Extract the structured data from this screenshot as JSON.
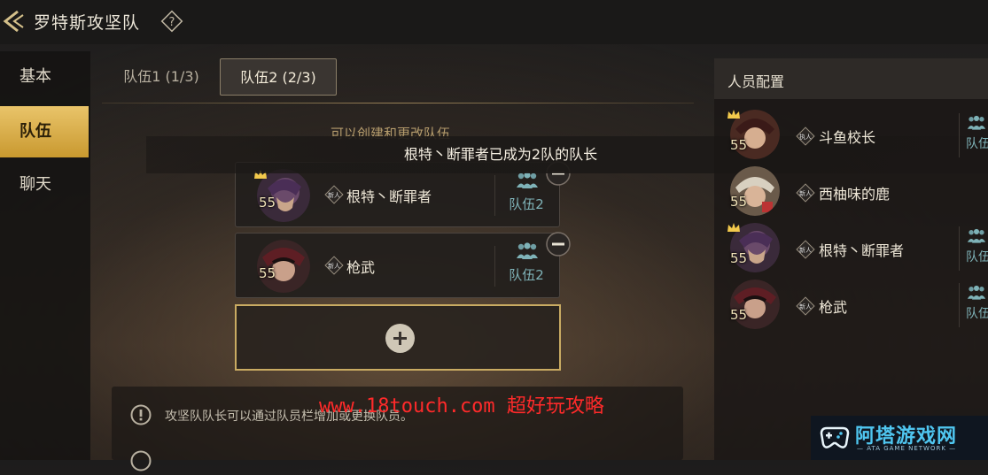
{
  "header": {
    "title": "罗特斯攻坚队",
    "back_icon": "back-arrow-icon",
    "help_icon": "help-icon"
  },
  "sidebar": {
    "items": [
      {
        "label": "基本",
        "active": false
      },
      {
        "label": "队伍",
        "active": true
      },
      {
        "label": "聊天",
        "active": false
      }
    ]
  },
  "tabs": [
    {
      "label": "队伍1 (1/3)",
      "active": false
    },
    {
      "label": "队伍2 (2/3)",
      "active": true
    }
  ],
  "team_panel": {
    "hint": "可以创建和更改队伍",
    "members": [
      {
        "level": "55",
        "badge": "新人",
        "name": "根特丶断罪者",
        "team": "队伍2",
        "leader": true
      },
      {
        "level": "55",
        "badge": "新人",
        "name": "枪武",
        "team": "队伍2",
        "leader": false
      }
    ]
  },
  "toast": {
    "text": "根特丶断罪者已成为2队的队长"
  },
  "rules": [
    {
      "text": "攻坚队队长可以通过队员栏增加或更换队员。"
    },
    {
      "text": ""
    }
  ],
  "watermark": {
    "text": "www.18touch.com 超好玩攻略"
  },
  "roster": {
    "title": "人员配置",
    "members": [
      {
        "level": "55",
        "badge": "执人",
        "name": "斗鱼校长",
        "team": "队伍",
        "leader": true
      },
      {
        "level": "55",
        "badge": "新人",
        "name": "西柚味的鹿",
        "team": "",
        "leader": false
      },
      {
        "level": "55",
        "badge": "新人",
        "name": "根特丶断罪者",
        "team": "队伍",
        "leader": true
      },
      {
        "level": "55",
        "badge": "新人",
        "name": "枪武",
        "team": "队伍",
        "leader": false
      }
    ]
  },
  "logo": {
    "name": "阿塔游戏网",
    "sub": "— ATA GAME NETWORK —"
  },
  "colors": {
    "accent_gold": "#d9b04c",
    "team_teal": "#7fb3b8",
    "watermark_red": "#ff2a2a"
  }
}
